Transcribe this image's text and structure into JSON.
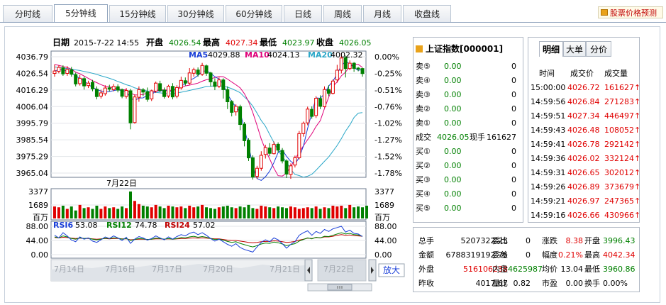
{
  "tabs": [
    {
      "label": "分时线",
      "active": false
    },
    {
      "label": "5分钟线",
      "active": true
    },
    {
      "label": "15分钟线",
      "active": false
    },
    {
      "label": "30分钟线",
      "active": false
    },
    {
      "label": "60分钟线",
      "active": false
    },
    {
      "label": "日线",
      "active": false
    },
    {
      "label": "周线",
      "active": false
    },
    {
      "label": "月线",
      "active": false
    },
    {
      "label": "收盘线",
      "active": false
    }
  ],
  "predict_label": "股票价格预测",
  "chart": {
    "date_label": "日期",
    "date_value": "2015-7-22 14:55",
    "open_label": "开盘",
    "open_value": "4026.54",
    "high_label": "最高",
    "high_value": "4027.34",
    "low_label": "最低",
    "low_value": "4023.97",
    "close_label": "收盘",
    "close_value": "4026.05",
    "ma5_label": "MA5",
    "ma5_value": "4029.88",
    "ma10_label": "MA10",
    "ma10_value": "4024.13",
    "ma20_label": "MA20",
    "ma20_value": "4002.32",
    "price_ticks": [
      "4036.79",
      "4026.54",
      "4016.29",
      "4006.04",
      "3995.79",
      "3985.54",
      "3975.29",
      "3965.04"
    ],
    "pct_ticks": [
      "0.00%",
      "-0.25%",
      "-0.51%",
      "-0.76%",
      "-1.02%",
      "-1.27%",
      "-1.52%",
      "-1.78%"
    ],
    "vol_date_label": "7月22日",
    "vol_ticks": [
      "3377",
      "1689",
      "百万"
    ],
    "vol_ticks_right": [
      "3377",
      "1689",
      "百万"
    ],
    "rsi6_label": "RSI6",
    "rsi6_value": "53.08",
    "rsi12_label": "RSI12",
    "rsi12_value": "74.78",
    "rsi24_label": "RSI24",
    "rsi24_value": "57.02",
    "rsi_ticks": [
      "88.00",
      "44.00",
      "0.00"
    ],
    "nav_dates": [
      "7月14日",
      "7月16日",
      "7月17日",
      "7月20日",
      "7月21日",
      "7月22日"
    ],
    "zoom_label": "放大"
  },
  "chart_data": {
    "type": "candlestick",
    "price_range": [
      3960,
      4040
    ],
    "candles": [
      [
        4026.5,
        4028.0,
        4024.5,
        4032.0
      ],
      [
        4027.8,
        4030.2,
        4026.6,
        4031.5
      ],
      [
        4030.0,
        4026.2,
        4025.0,
        4031.5
      ],
      [
        4026.5,
        4029.0,
        4025.0,
        4031.0
      ],
      [
        4028.8,
        4026.0,
        4024.5,
        4030.5
      ],
      [
        4025.8,
        4020.0,
        4018.5,
        4027.0
      ],
      [
        4020.2,
        4023.5,
        4019.0,
        4025.5
      ],
      [
        4023.3,
        4018.8,
        4016.5,
        4024.5
      ],
      [
        4019.0,
        4020.5,
        4017.5,
        4022.0
      ],
      [
        4021.0,
        4017.0,
        4015.5,
        4022.5
      ],
      [
        4016.8,
        4012.2,
        4010.5,
        4018.5
      ],
      [
        4012.5,
        4014.5,
        4011.0,
        4016.5
      ],
      [
        4014.0,
        4017.5,
        4012.8,
        4019.2
      ],
      [
        4017.6,
        4016.8,
        4015.5,
        4019.5
      ],
      [
        4016.5,
        4018.5,
        4015.5,
        4020.0
      ],
      [
        4018.3,
        4016.2,
        4014.8,
        4019.8
      ],
      [
        4016.5,
        4012.4,
        4011.2,
        4017.2
      ],
      [
        4012.3,
        4016.0,
        4011.0,
        4017.5
      ],
      [
        4015.8,
        3996.0,
        3992.0,
        4017.0
      ],
      [
        3996.2,
        4012.0,
        3995.5,
        4013.5
      ],
      [
        4011.8,
        4016.5,
        4009.0,
        4018.5
      ],
      [
        4016.4,
        4015.0,
        4012.5,
        4017.5
      ],
      [
        4015.2,
        4010.5,
        4009.0,
        4017.8
      ],
      [
        4010.8,
        4015.8,
        4009.5,
        4016.5
      ],
      [
        4015.6,
        4020.5,
        4014.5,
        4021.5
      ],
      [
        4020.2,
        4016.0,
        4015.0,
        4022.0
      ],
      [
        4016.2,
        4012.2,
        4011.0,
        4017.8
      ],
      [
        4012.6,
        4018.6,
        4011.5,
        4019.5
      ],
      [
        4018.5,
        4012.0,
        4010.5,
        4020.5
      ],
      [
        4012.5,
        4017.8,
        4011.2,
        4019.2
      ],
      [
        4017.6,
        4022.2,
        4016.5,
        4024.5
      ],
      [
        4022.0,
        4020.5,
        4019.0,
        4024.0
      ],
      [
        4020.5,
        4026.8,
        4019.5,
        4029.8
      ],
      [
        4026.6,
        4028.8,
        4024.5,
        4030.0
      ],
      [
        4028.6,
        4026.0,
        4024.5,
        4030.2
      ],
      [
        4026.0,
        4031.4,
        4025.0,
        4033.0
      ],
      [
        4031.2,
        4026.6,
        4025.0,
        4032.0
      ],
      [
        4026.8,
        4021.3,
        4018.5,
        4027.5
      ],
      [
        4021.2,
        4018.5,
        4016.2,
        4023.5
      ],
      [
        4018.6,
        4022.5,
        4017.5,
        4024.0
      ],
      [
        4022.5,
        4016.5,
        4011.0,
        4023.5
      ],
      [
        4016.5,
        4009.0,
        4004.5,
        4018.5
      ],
      [
        4009.2,
        4002.5,
        4000.0,
        4010.0
      ],
      [
        4002.8,
        4006.2,
        4000.5,
        4007.5
      ],
      [
        4006.0,
        3995.0,
        3991.5,
        4007.2
      ],
      [
        3995.2,
        3985.0,
        3981.5,
        3996.5
      ],
      [
        3985.3,
        3974.4,
        3972.5,
        3986.5
      ],
      [
        3974.5,
        3962.6,
        3961.0,
        3976.0
      ],
      [
        3963.0,
        3968.0,
        3961.5,
        3969.5
      ],
      [
        3968.0,
        3976.0,
        3966.5,
        3978.5
      ],
      [
        3976.5,
        3980.8,
        3974.0,
        3982.5
      ],
      [
        3980.5,
        3977.2,
        3975.5,
        3983.5
      ],
      [
        3977.0,
        3982.7,
        3976.5,
        3984.5
      ],
      [
        3982.8,
        3979.2,
        3977.5,
        3984.0
      ],
      [
        3979.0,
        3972.5,
        3971.0,
        3980.5
      ],
      [
        3972.5,
        3964.4,
        3962.0,
        3973.5
      ],
      [
        3964.2,
        3969.5,
        3961.5,
        3971.0
      ],
      [
        3970.0,
        3974.5,
        3968.5,
        3975.8
      ],
      [
        3974.5,
        3989.4,
        3973.5,
        3991.0
      ],
      [
        3989.4,
        3995.8,
        3987.5,
        3996.8
      ],
      [
        3996.0,
        4004.5,
        3994.5,
        4006.0
      ],
      [
        4004.3,
        4000.0,
        3998.5,
        4006.2
      ],
      [
        4000.5,
        4011.2,
        3999.0,
        4012.5
      ],
      [
        4011.0,
        4006.2,
        4004.5,
        4013.0
      ],
      [
        4006.0,
        4016.6,
        4005.5,
        4018.5
      ],
      [
        4016.6,
        4014.2,
        4012.5,
        4019.2
      ],
      [
        4014.2,
        4021.8,
        4013.5,
        4022.8
      ],
      [
        4022.5,
        4028.5,
        4020.8,
        4031.8
      ],
      [
        4028.5,
        4036.0,
        4026.5,
        4039.0
      ],
      [
        4036.2,
        4029.5,
        4024.0,
        4037.5
      ],
      [
        4029.5,
        4032.8,
        4028.5,
        4034.5
      ],
      [
        4032.8,
        4029.6,
        4027.5,
        4033.5
      ],
      [
        4029.8,
        4029.2,
        4027.8,
        4030.5
      ],
      [
        4029.5,
        4026.4,
        4024.5,
        4030.0
      ]
    ],
    "ma5": [
      4028.0,
      4028.8,
      4028.6,
      4028.1,
      4026.6,
      4025.2,
      4023.3,
      4021.9,
      4019.7,
      4017.9,
      4016.6,
      4015.6,
      4014.9,
      4015.3,
      4015.9,
      4016.4,
      4015.9,
      4015.5,
      4011.4,
      4009.8,
      4011.3,
      4011.4,
      4013.1,
      4013.3,
      4015.7,
      4015.6,
      4016.1,
      4015.7,
      4015.3,
      4017.5,
      4018.6,
      4020.2,
      4022.3,
      4023.4,
      4025.3,
      4027.7,
      4028.2,
      4026.6,
      4024.5,
      4023.0,
      4019.7,
      4013.7,
      4009.3,
      4005.8,
      4002.5,
      3992.5,
      3982.2,
      3969.6,
      3961.7,
      3960.5,
      3962.8,
      3966.2,
      3971.5,
      3977.7,
      3979.4,
      3975.3,
      3972.3,
      3970.4,
      3974.7,
      3981.7,
      3992.6,
      4002.1,
      4011.4,
      4011.2,
      4013.9,
      4018.7,
      4021.7,
      4026.2,
      4031.3,
      4033.9,
      4032.5,
      4030.1,
      4028.4,
      4028.9
    ],
    "ma10": [
      4032.0,
      4031.5,
      4030.8,
      4030.2,
      4029.1,
      4027.3,
      4026.3,
      4024.9,
      4023.5,
      4022.0,
      4020.8,
      4019.6,
      4018.6,
      4018.2,
      4017.6,
      4016.9,
      4016.5,
      4016.3,
      4014.5,
      4013.2,
      4013.3,
      4013.5,
      4014.5,
      4014.6,
      4016.0,
      4016.4,
      4016.4,
      4016.2,
      4016.0,
      4016.9,
      4017.8,
      4018.8,
      4019.3,
      4019.9,
      4020.5,
      4021.7,
      4022.6,
      4023.0,
      4024.0,
      4024.6,
      4024.5,
      4023.0,
      4021.2,
      4019.5,
      4017.6,
      4014.1,
      4009.1,
      4002.4,
      3994.4,
      3986.1,
      3979.4,
      3973.8,
      3968.0,
      3963.4,
      3963.2,
      3965.0,
      3968.9,
      3973.6,
      3977.8,
      3981.9,
      3985.6,
      3989.3,
      3993.8,
      3997.4,
      4004.9,
      4011.9,
      4018.5,
      4021.3,
      4025.0,
      4027.3,
      4030.9,
      4032.3,
      4032.1,
      4030.2
    ],
    "ma20": [
      4030.5,
      4030.2,
      4029.9,
      4029.5,
      4029.2,
      4028.7,
      4028.3,
      4027.7,
      4027.2,
      4026.6,
      4025.9,
      4025.0,
      4024.3,
      4023.5,
      4022.6,
      4021.5,
      4020.6,
      4019.5,
      4018.8,
      4017.6,
      4017.0,
      4016.2,
      4015.7,
      4015.1,
      4014.8,
      4014.5,
      4014.2,
      4013.9,
      4013.8,
      4014.5,
      4014.9,
      4015.4,
      4016.0,
      4016.6,
      4017.2,
      4017.7,
      4018.5,
      4018.6,
      4018.9,
      4018.9,
      4018.6,
      4018.0,
      4017.1,
      4015.9,
      4014.6,
      4012.0,
      4009.6,
      4006.3,
      4002.0,
      3997.5,
      3993.9,
      3988.9,
      3983.9,
      3979.1,
      3975.1,
      3972.0,
      3967.3,
      3964.2,
      3963.5,
      3962.5,
      3963.1,
      3964.3,
      3966.8,
      3969.6,
      3972.3,
      3975.0,
      3978.5,
      3982.1,
      3986.3,
      3990.9,
      3994.7,
      3999.3,
      4002.0,
      4002.3
    ],
    "volume_range": [
      0,
      3377
    ],
    "volume": [
      1500,
      1400,
      1600,
      1200,
      1500,
      1000,
      1700,
      1300,
      1400,
      1200,
      1600,
      1200,
      1500,
      1300,
      1400,
      1200,
      1500,
      1300,
      3377,
      2200,
      1800,
      1600,
      1500,
      1400,
      1700,
      1500,
      1300,
      1600,
      1500,
      1400,
      1500,
      1300,
      1600,
      1400,
      1500,
      1700,
      1400,
      1300,
      1200,
      1400,
      1500,
      1600,
      1400,
      1300,
      1500,
      1400,
      1700,
      1300,
      1200,
      1600,
      1500,
      1400,
      1300,
      1500,
      1400,
      1300,
      1500,
      1400,
      1200,
      1300,
      1400,
      1300,
      1500,
      1200,
      1400,
      1300,
      1600,
      1500,
      1600,
      1300,
      1700,
      1400,
      1500,
      1400,
      1600
    ],
    "rsi_range": [
      0,
      88
    ],
    "rsi6": [
      60,
      52,
      68,
      58,
      45,
      40,
      55,
      48,
      52,
      42,
      38,
      46,
      55,
      50,
      58,
      52,
      44,
      54,
      35,
      48,
      56,
      52,
      45,
      50,
      58,
      52,
      46,
      55,
      48,
      56,
      62,
      58,
      66,
      70,
      62,
      68,
      60,
      50,
      42,
      48,
      40,
      32,
      26,
      34,
      22,
      16,
      12,
      8,
      24,
      38,
      46,
      40,
      52,
      46,
      34,
      20,
      32,
      40,
      60,
      68,
      74,
      60,
      72,
      66,
      78,
      72,
      80,
      84,
      88,
      70,
      76,
      66,
      64,
      56
    ],
    "rsi12": [
      55,
      52,
      58,
      55,
      50,
      48,
      52,
      50,
      51,
      48,
      46,
      48,
      51,
      50,
      52,
      51,
      48,
      50,
      44,
      47,
      50,
      49,
      47,
      48,
      51,
      50,
      48,
      50,
      48,
      50,
      53,
      52,
      55,
      57,
      54,
      56,
      54,
      50,
      47,
      48,
      45,
      41,
      38,
      40,
      35,
      31,
      27,
      24,
      28,
      33,
      36,
      35,
      39,
      37,
      33,
      28,
      31,
      34,
      42,
      47,
      52,
      49,
      54,
      52,
      57,
      56,
      60,
      64,
      68,
      64,
      66,
      62,
      61,
      57
    ],
    "rsi24": [
      53,
      52,
      54,
      53,
      51,
      50,
      51,
      50,
      50,
      49,
      48,
      49,
      50,
      49,
      50,
      50,
      49,
      49,
      46,
      47,
      48,
      48,
      47,
      48,
      49,
      49,
      48,
      49,
      48,
      49,
      50,
      50,
      51,
      52,
      51,
      52,
      51,
      50,
      49,
      49,
      47,
      45,
      44,
      44,
      42,
      40,
      38,
      37,
      38,
      40,
      41,
      41,
      43,
      42,
      40,
      38,
      39,
      41,
      45,
      48,
      51,
      50,
      53,
      52,
      55,
      55,
      57,
      60,
      62,
      60,
      61,
      59,
      58,
      57
    ]
  },
  "quote": {
    "title": "上证指数[000001]",
    "sell": [
      {
        "label": "卖⑤",
        "price": "0.00",
        "vol": "0"
      },
      {
        "label": "卖④",
        "price": "0.00",
        "vol": "0"
      },
      {
        "label": "卖③",
        "price": "0.00",
        "vol": "0"
      },
      {
        "label": "卖②",
        "price": "0.00",
        "vol": "0"
      },
      {
        "label": "卖①",
        "price": "0.00",
        "vol": "0"
      }
    ],
    "deal": {
      "label": "成交",
      "price": "4026.05",
      "hand_label": "现手",
      "vol": "161627"
    },
    "buy": [
      {
        "label": "买①",
        "price": "0.00",
        "vol": "0"
      },
      {
        "label": "买②",
        "price": "0.00",
        "vol": "0"
      },
      {
        "label": "买③",
        "price": "0.00",
        "vol": "0"
      },
      {
        "label": "买④",
        "price": "0.00",
        "vol": "0"
      },
      {
        "label": "买⑤",
        "price": "0.00",
        "vol": "0"
      }
    ]
  },
  "detail": {
    "tabs": [
      "明细",
      "大单",
      "分价"
    ],
    "headers": [
      "时间",
      "成交价",
      "成交量"
    ],
    "rows": [
      {
        "time": "15:00:00",
        "price": "4026.72",
        "vol": "161627↑"
      },
      {
        "time": "14:59:56",
        "price": "4026.84",
        "vol": "271283↑"
      },
      {
        "time": "14:59:51",
        "price": "4027.34",
        "vol": "446497↑"
      },
      {
        "time": "14:59:43",
        "price": "4026.48",
        "vol": "108052↑"
      },
      {
        "time": "14:59:41",
        "price": "4026.78",
        "vol": "292142↑"
      },
      {
        "time": "14:59:36",
        "price": "4026.02",
        "vol": "332124↑"
      },
      {
        "time": "14:59:31",
        "price": "4026.65",
        "vol": "302012↑"
      },
      {
        "time": "14:59:26",
        "price": "4026.89",
        "vol": "373679↑"
      },
      {
        "time": "14:59:21",
        "price": "4026.97",
        "vol": "247365↑"
      },
      {
        "time": "14:59:16",
        "price": "4026.66",
        "vol": "430966↑"
      }
    ]
  },
  "stats": {
    "r1": {
      "a_l": "总手",
      "a_v": "5207322.25",
      "b_l": "委比",
      "b_v": "0",
      "c_l": "涨跌",
      "c_v": "8.38",
      "d_l": "开盘",
      "d_v": "3996.43"
    },
    "r2": {
      "a_l": "金额",
      "a_v": "6788319192.75",
      "b_l": "委差",
      "b_v": "0",
      "c_l": "幅度",
      "c_v": "0.21%",
      "d_l": "最高",
      "d_v": "4042.34"
    },
    "r3": {
      "a_l": "外盘",
      "a_v": "516106238",
      "b_l": "内盘",
      "b_v": "4625987",
      "c_l": "均价",
      "c_v": "13.04",
      "d_l": "最低",
      "d_v": "3960.86"
    },
    "r4": {
      "a_l": "昨收",
      "a_v": "4017.67",
      "b_l": "量比",
      "b_v": "0.82",
      "c_l": "市盈",
      "c_v": "0.00",
      "d_l": "换手",
      "d_v": "0.00%"
    }
  },
  "colors": {
    "up": "#e00000",
    "down": "#008000",
    "ma5": "#1a3fd8",
    "ma10": "#e0007a",
    "ma20": "#2aa7c8",
    "rsi6": "#1a3fd8",
    "rsi12": "#008000",
    "rsi24": "#c00000"
  }
}
